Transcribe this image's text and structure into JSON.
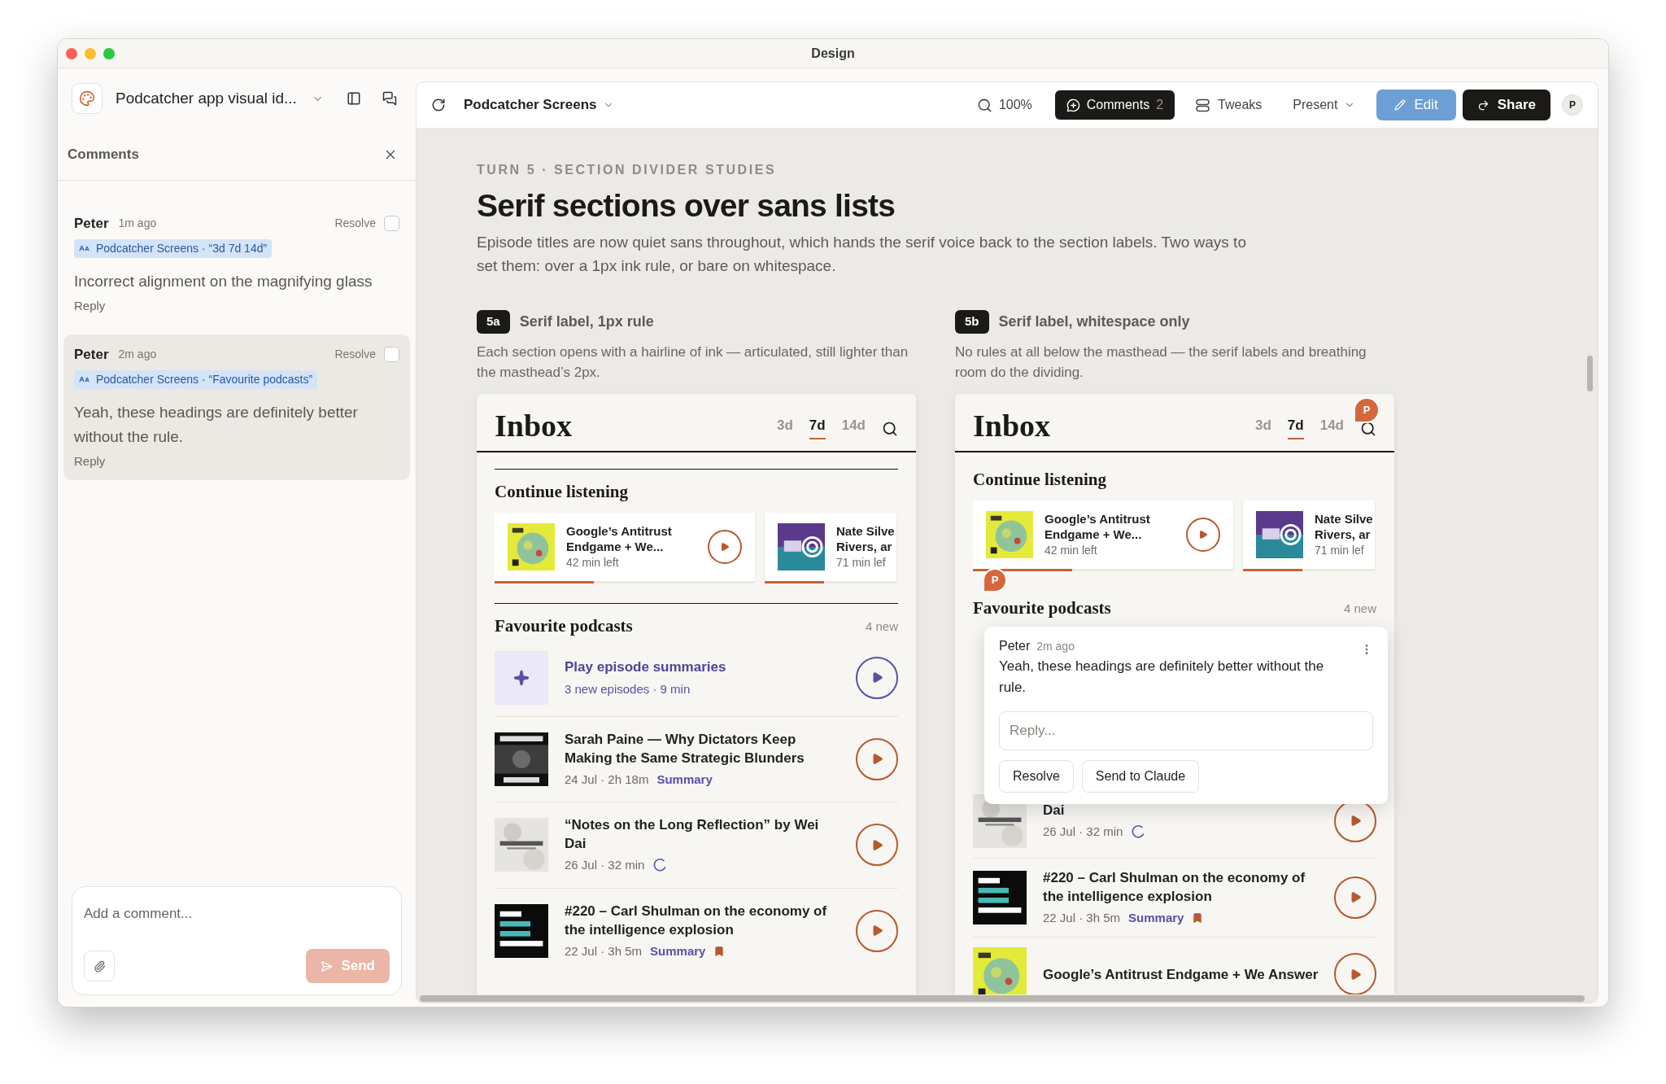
{
  "window": {
    "title": "Design"
  },
  "sidebar": {
    "project": "Podcatcher app visual id...",
    "heading": "Comments",
    "comments": [
      {
        "author": "Peter",
        "time": "1m ago",
        "resolve": "Resolve",
        "resolved": false,
        "target": "Podcatcher Screens · “3d 7d 14d”",
        "text": "Incorrect alignment on the magnifying glass",
        "reply": "Reply",
        "selected": false
      },
      {
        "author": "Peter",
        "time": "2m ago",
        "resolve": "Resolve",
        "resolved": false,
        "target": "Podcatcher Screens · “Favourite podcasts”",
        "text": "Yeah, these headings are definitely better without the rule.",
        "reply": "Reply",
        "selected": true
      }
    ],
    "composer": {
      "placeholder": "Add a comment...",
      "send": "Send",
      "disabled": true
    }
  },
  "toolbar": {
    "file": "Podcatcher Screens",
    "zoom": "100%",
    "comments": {
      "label": "Comments",
      "count": "2",
      "on": true
    },
    "tweaks": "Tweaks",
    "present": "Present",
    "edit": "Edit",
    "share": "Share",
    "avatar": "P"
  },
  "canvas": {
    "eyebrow": "TURN 5 · SECTION DIVIDER STUDIES",
    "title": "Serif sections over sans lists",
    "description": "Episode titles are now quiet sans throughout, which hands the serif voice back to the section labels. Two ways to set them: over a 1px ink rule, or bare on whitespace.",
    "variants": [
      {
        "badge": "5a",
        "label": "Serif label, 1px rule",
        "description": "Each section opens with a hairline of ink — articulated, still lighter than the masthead’s 2px.",
        "rule": true,
        "screen": {
          "title": "Inbox",
          "tabs": [
            {
              "label": "3d",
              "selected": false
            },
            {
              "label": "7d",
              "selected": true
            },
            {
              "label": "14d",
              "selected": false
            }
          ],
          "continue": {
            "title": "Continue listening",
            "cards": [
              {
                "title_lines": [
                  "Google’s Antitrust",
                  "Endgame + We..."
                ],
                "time_left": "42 min left",
                "level": 0.38
              },
              {
                "title_lines": [
                  "Nate Silve",
                  "Rivers, ar"
                ],
                "time_left": "71 min lef",
                "level": 0.45
              }
            ]
          },
          "favourites": {
            "title": "Favourite podcasts",
            "count": "4 new",
            "summary": {
              "title": "Play episode summaries",
              "meta": "3 new episodes · 9 min"
            },
            "episodes": [
              {
                "title": "Sarah Paine — Why Dictators Keep Making the Same Strategic Blunders",
                "meta": "24 Jul · 2h 18m",
                "summary": "Summary",
                "loading": false,
                "bookmarked": false
              },
              {
                "title": "“Notes on the Long Reflection” by Wei Dai",
                "meta": "26 Jul · 32 min",
                "loading": true,
                "bookmarked": false
              },
              {
                "title": "#220 – Carl Shulman on the economy of the intelligence explosion",
                "meta": "22 Jul · 3h 5m",
                "summary": "Summary",
                "loading": false,
                "bookmarked": true
              }
            ]
          }
        }
      },
      {
        "badge": "5b",
        "label": "Serif label, whitespace only",
        "description": "No rules at all below the masthead — the serif labels and breathing room do the dividing.",
        "rule": false,
        "screen": {
          "title": "Inbox",
          "pin": "P",
          "tabs": [
            {
              "label": "3d",
              "selected": false
            },
            {
              "label": "7d",
              "selected": true
            },
            {
              "label": "14d",
              "selected": false
            }
          ],
          "continue": {
            "title": "Continue listening",
            "cards": [
              {
                "title_lines": [
                  "Google’s Antitrust",
                  "Endgame + We..."
                ],
                "time_left": "42 min left",
                "level": 0.38
              },
              {
                "title_lines": [
                  "Nate Silve",
                  "Rivers, ar"
                ],
                "time_left": "71 min lef",
                "level": 0.45
              }
            ]
          },
          "favourites": {
            "title": "Favourite podcasts",
            "count": "4 new",
            "pin": "P",
            "comment": {
              "author": "Peter",
              "time": "2m ago",
              "text": "Yeah, these headings are definitely better without the rule.",
              "placeholder": "Reply...",
              "buttons": [
                "Resolve",
                "Send to Claude"
              ]
            },
            "episodes": [
              {
                "title": "Dai",
                "meta": "26 Jul · 32 min",
                "loading": true,
                "bookmarked": false
              },
              {
                "title": "#220 – Carl Shulman on the economy of the intelligence explosion",
                "meta": "22 Jul · 3h 5m",
                "summary": "Summary",
                "loading": false,
                "bookmarked": true
              },
              {
                "title": "Google’s Antitrust Endgame + We Answer",
                "loading": false,
                "bookmarked": false
              }
            ]
          }
        }
      }
    ]
  }
}
